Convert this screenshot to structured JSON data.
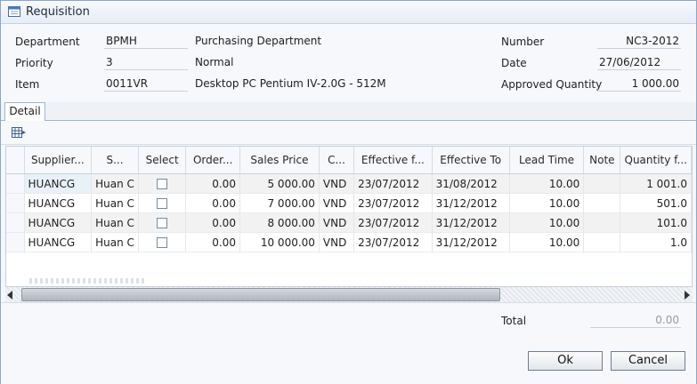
{
  "window": {
    "title": "Requisition",
    "title_icon": "calendar-form-icon"
  },
  "header": {
    "department_label": "Department",
    "department_code": "BPMH",
    "department_name": "Purchasing Department",
    "priority_label": "Priority",
    "priority_code": "3",
    "priority_name": "Normal",
    "item_label": "Item",
    "item_code": "0011VR",
    "item_name": "Desktop PC Pentium IV-2.0G - 512M",
    "number_label": "Number",
    "number_value": "NC3-2012",
    "date_label": "Date",
    "date_value": "27/06/2012",
    "approved_qty_label": "Approved Quantity",
    "approved_qty_value": "1 000.00"
  },
  "tabs": [
    {
      "label": "Detail",
      "active": true
    }
  ],
  "toolbar": {
    "columns_icon": "column-chooser-icon"
  },
  "grid": {
    "columns": [
      "Supplier...",
      "S...",
      "Select",
      "Order...",
      "Sales Price",
      "C...",
      "Effective f...",
      "Effective To",
      "Lead Time",
      "Note",
      "Quantity f..."
    ],
    "rows": [
      {
        "supplier": "HUANCG",
        "s": "Huan C",
        "select": false,
        "order": "0.00",
        "sales_price": "5 000.00",
        "currency": "VND",
        "eff_from": "23/07/2012",
        "eff_to": "31/08/2012",
        "lead_time": "10.00",
        "note": "",
        "quantity": "1 001.0"
      },
      {
        "supplier": "HUANCG",
        "s": "Huan C",
        "select": false,
        "order": "0.00",
        "sales_price": "7 000.00",
        "currency": "VND",
        "eff_from": "23/07/2012",
        "eff_to": "31/12/2012",
        "lead_time": "10.00",
        "note": "",
        "quantity": "501.0"
      },
      {
        "supplier": "HUANCG",
        "s": "Huan C",
        "select": false,
        "order": "0.00",
        "sales_price": "8 000.00",
        "currency": "VND",
        "eff_from": "23/07/2012",
        "eff_to": "31/12/2012",
        "lead_time": "10.00",
        "note": "",
        "quantity": "101.0"
      },
      {
        "supplier": "HUANCG",
        "s": "Huan C",
        "select": false,
        "order": "0.00",
        "sales_price": "10 000.00",
        "currency": "VND",
        "eff_from": "23/07/2012",
        "eff_to": "31/12/2012",
        "lead_time": "10.00",
        "note": "",
        "quantity": "1.0"
      }
    ]
  },
  "footer": {
    "total_label": "Total",
    "total_value": "0.00",
    "ok_label": "Ok",
    "cancel_label": "Cancel"
  }
}
